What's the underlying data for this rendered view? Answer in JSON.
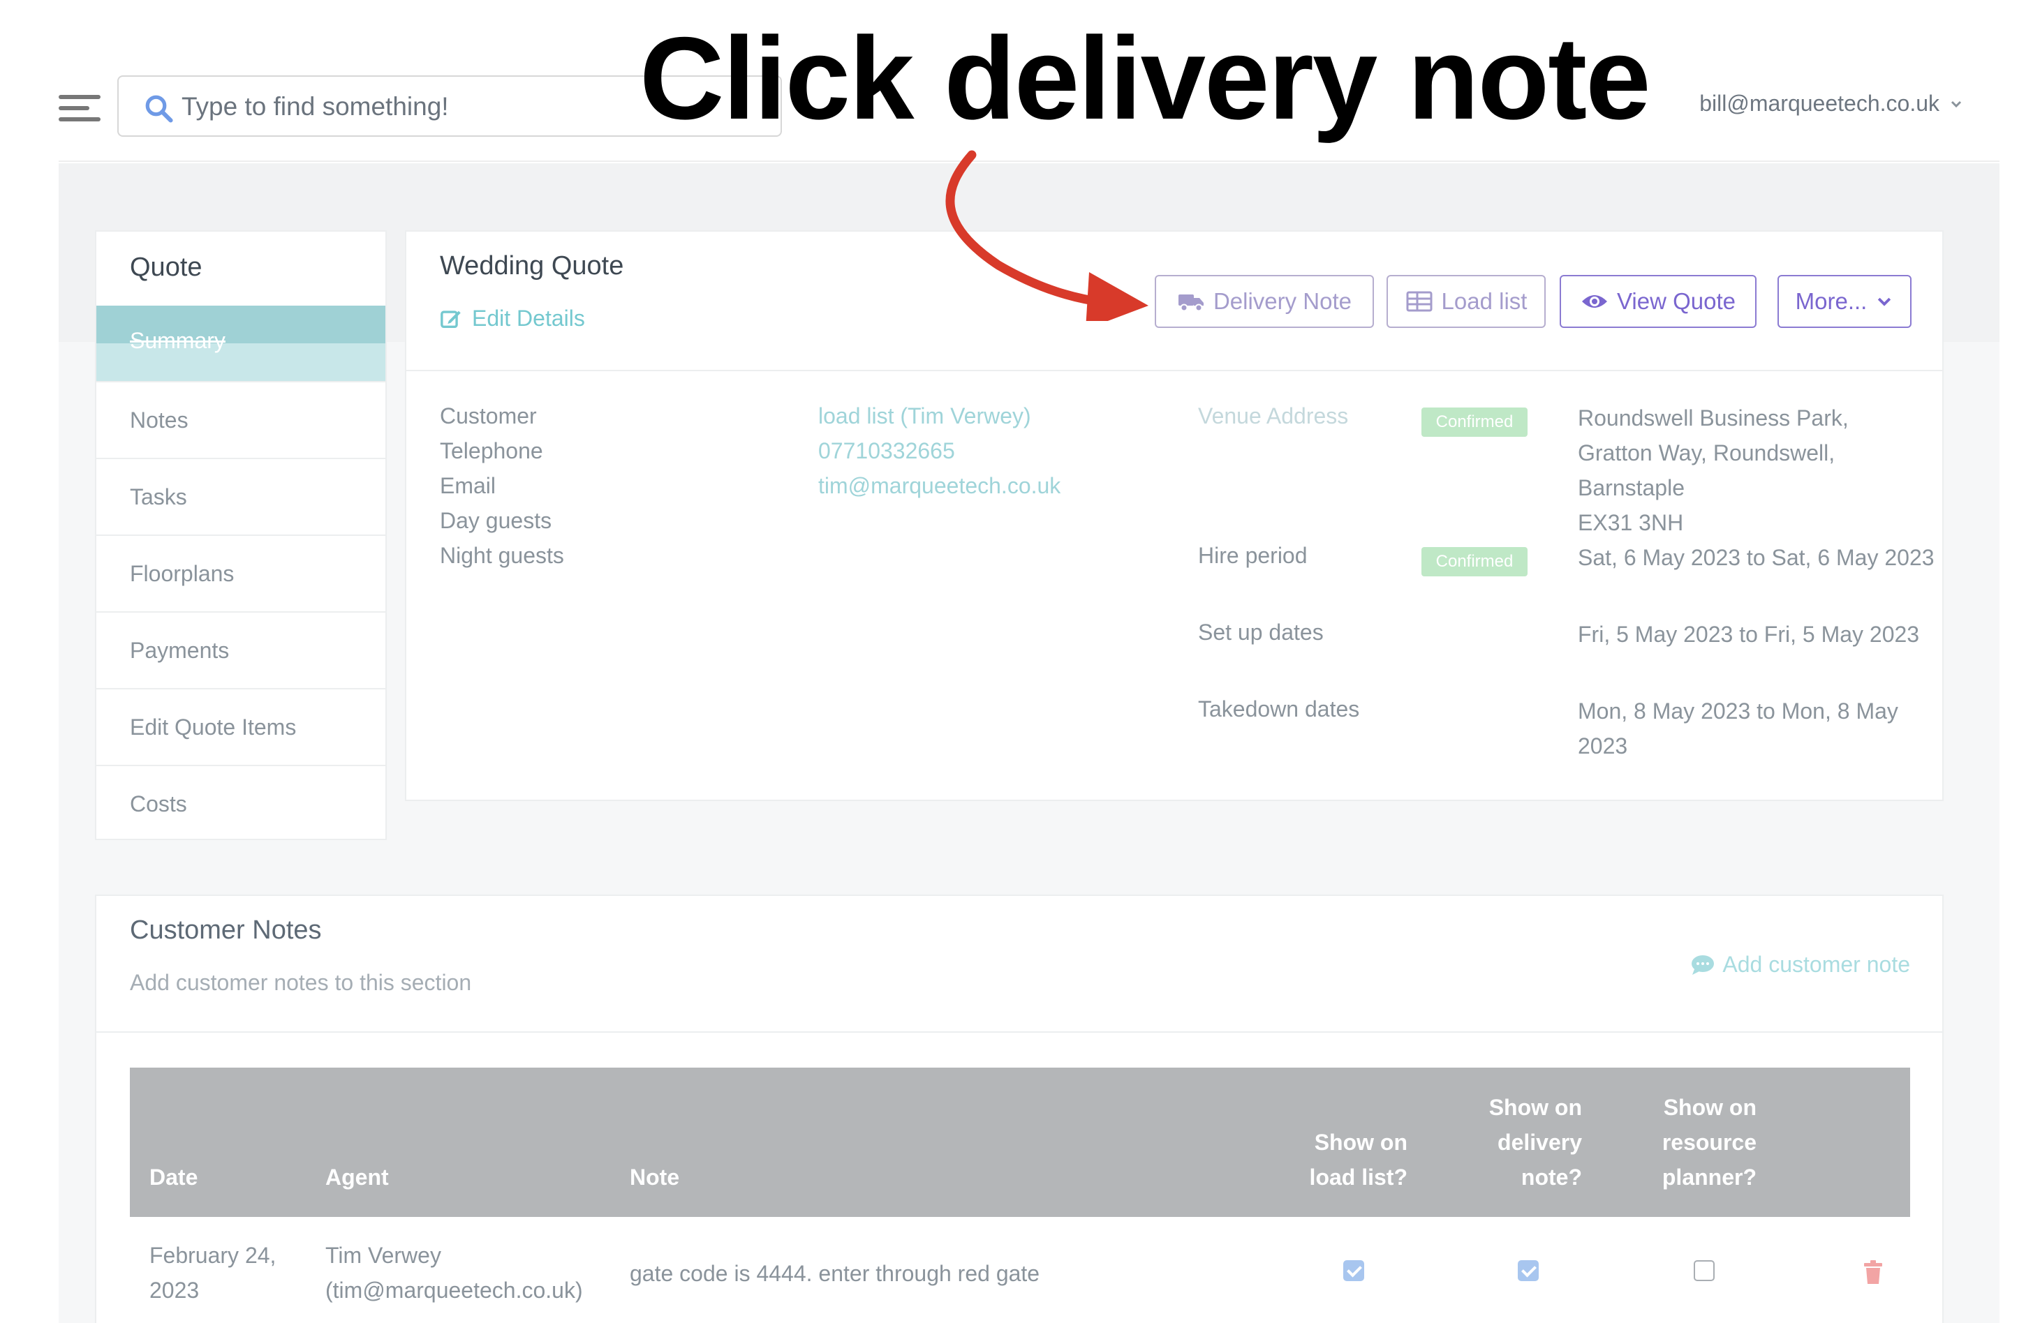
{
  "annotation": {
    "text": "Click delivery note"
  },
  "header": {
    "search_placeholder": "Type to find something!",
    "user_email": "bill@marqueetech.co.uk"
  },
  "sidebar": {
    "title": "Quote",
    "items": [
      {
        "label": "Summary",
        "active": true
      },
      {
        "label": "Notes"
      },
      {
        "label": "Tasks"
      },
      {
        "label": "Floorplans"
      },
      {
        "label": "Payments"
      },
      {
        "label": "Edit Quote Items"
      },
      {
        "label": "Costs"
      }
    ]
  },
  "quote": {
    "title": "Wedding Quote",
    "edit_label": "Edit Details",
    "buttons": {
      "delivery_note": "Delivery Note",
      "load_list": "Load list",
      "view_quote": "View Quote",
      "more": "More..."
    },
    "fields": [
      {
        "label": "Customer",
        "value": "load list (Tim Verwey)"
      },
      {
        "label": "Telephone",
        "value": "07710332665"
      },
      {
        "label": "Email",
        "value": "tim@marqueetech.co.uk"
      },
      {
        "label": "Day guests",
        "value": ""
      },
      {
        "label": "Night guests",
        "value": ""
      }
    ],
    "details": {
      "venue_label": "Venue Address",
      "venue_badge": "Confirmed",
      "venue_lines": [
        "Roundswell Business Park,",
        "Gratton Way, Roundswell,",
        "Barnstaple",
        "EX31 3NH"
      ],
      "hire_label": "Hire period",
      "hire_badge": "Confirmed",
      "hire_value": "Sat, 6 May 2023 to Sat, 6 May 2023",
      "setup_label": "Set up dates",
      "setup_value": "Fri, 5 May 2023 to Fri, 5 May 2023",
      "takedown_label": "Takedown dates",
      "takedown_value": "Mon, 8 May 2023 to Mon, 8 May 2023"
    }
  },
  "customer_notes": {
    "title": "Customer Notes",
    "subtitle": "Add customer notes to this section",
    "add_label": "Add customer note",
    "columns": {
      "date": "Date",
      "agent": "Agent",
      "note": "Note",
      "load_list": "Show on load list?",
      "delivery_note": "Show on delivery note?",
      "resource_planner": "Show on resource planner?"
    },
    "rows": [
      {
        "date": "February 24, 2023",
        "agent_name": "Tim Verwey",
        "agent_email": "(tim@marqueetech.co.uk)",
        "note": "gate code is 4444. enter through red gate",
        "load_list": true,
        "delivery_note": true,
        "resource_planner": false
      }
    ]
  },
  "colors": {
    "accent_teal": "#74c8cf",
    "accent_purple": "#7a66cf",
    "badge_green": "#bfe8c6",
    "table_header": "#b4b6b8",
    "arrow_red": "#d83a2a"
  }
}
